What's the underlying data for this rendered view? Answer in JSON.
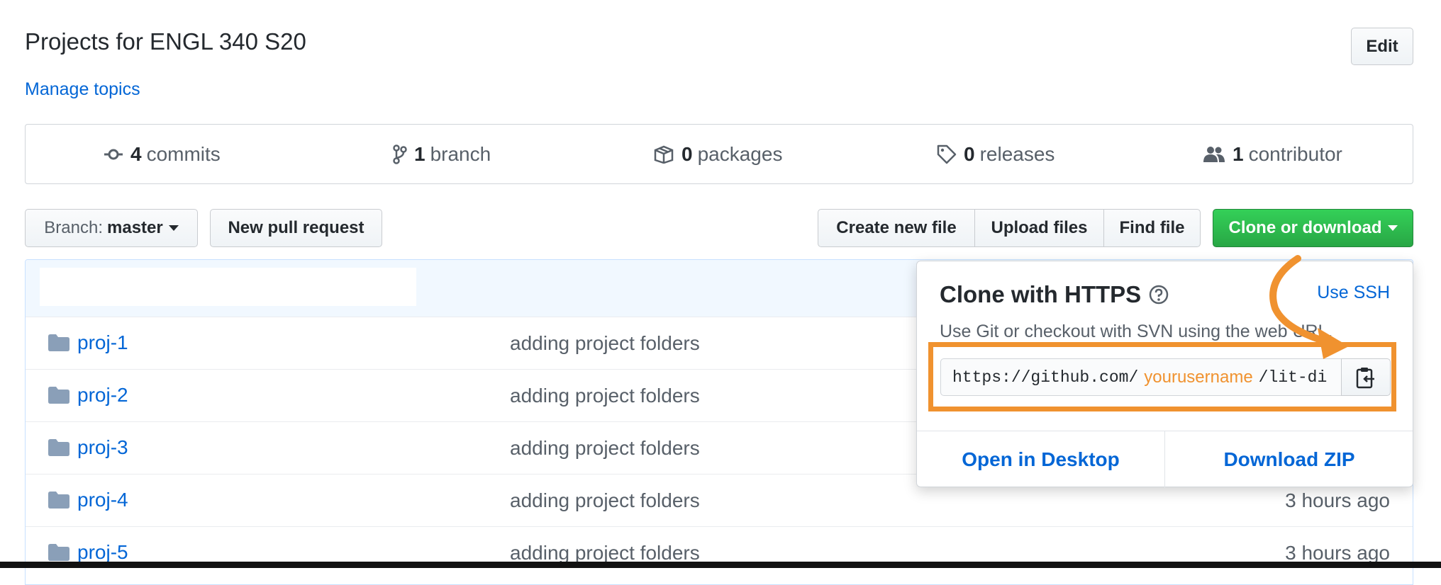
{
  "repo": {
    "description": "Projects for ENGL 340 S20",
    "manage_topics": "Manage topics",
    "edit_label": "Edit"
  },
  "stats": {
    "commits": {
      "count": "4",
      "label": "commits"
    },
    "branches": {
      "count": "1",
      "label": "branch"
    },
    "packages": {
      "count": "0",
      "label": "packages"
    },
    "releases": {
      "count": "0",
      "label": "releases"
    },
    "contributors": {
      "count": "1",
      "label": "contributor"
    }
  },
  "toolbar": {
    "branch_prefix": "Branch:",
    "branch_name": "master",
    "new_pr": "New pull request",
    "create_file": "Create new file",
    "upload_files": "Upload files",
    "find_file": "Find file",
    "clone": "Clone or download"
  },
  "files": [
    {
      "name": "proj-1",
      "message": "adding project folders",
      "age": ""
    },
    {
      "name": "proj-2",
      "message": "adding project folders",
      "age": ""
    },
    {
      "name": "proj-3",
      "message": "adding project folders",
      "age": ""
    },
    {
      "name": "proj-4",
      "message": "adding project folders",
      "age": "3 hours ago"
    },
    {
      "name": "proj-5",
      "message": "adding project folders",
      "age": "3 hours ago"
    }
  ],
  "clone_popover": {
    "title": "Clone with HTTPS",
    "use_ssh": "Use SSH",
    "description": "Use Git or checkout with SVN using the web URL.",
    "url_prefix": "https://github.com/",
    "url_user": "yourusername",
    "url_suffix": "/lit-di",
    "open_desktop": "Open in Desktop",
    "download_zip": "Download ZIP"
  },
  "colors": {
    "accent_orange": "#f0922f",
    "link_blue": "#0366d6",
    "clone_green": "#28a745"
  }
}
